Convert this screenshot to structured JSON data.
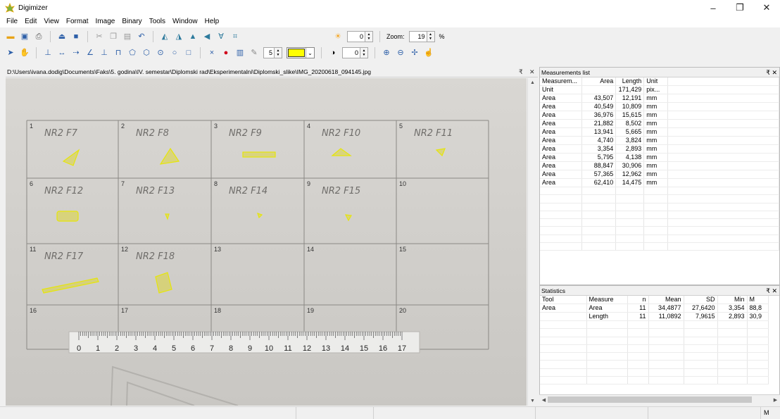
{
  "window": {
    "title": "Digimizer",
    "minimize": "–",
    "maximize": "❐",
    "close": "✕"
  },
  "menu": [
    "File",
    "Edit",
    "View",
    "Format",
    "Image",
    "Binary",
    "Tools",
    "Window",
    "Help"
  ],
  "toolbar": {
    "brightness_value": "0",
    "contrast_value": "0",
    "zoom_label": "Zoom:",
    "zoom_value": "19",
    "zoom_unit": "%",
    "line_width_value": "5",
    "fill_color": "#ffff00"
  },
  "image": {
    "path": "D:\\Users\\ivana.dodig\\Documents\\Faks\\5. godina\\IV. semestar\\Diplomski rad\\Eksperimentalni\\Diplomski_slike\\IMG_20200618_094145.jpg",
    "grid_numbers": [
      "1",
      "2",
      "3",
      "4",
      "5",
      "6",
      "7",
      "8",
      "9",
      "10",
      "11",
      "12",
      "13",
      "14",
      "15",
      "16",
      "17",
      "18",
      "19",
      "20"
    ],
    "labels": [
      "NR2 F7",
      "NR2 F8",
      "NR2 F9",
      "NR2 F10",
      "NR2 F11",
      "NR2 F12",
      "NR2 F13",
      "NR2 F14",
      "NR2 F15",
      "NR2 F17",
      "NR2 F18"
    ],
    "ruler_numbers": [
      "0",
      "1",
      "2",
      "3",
      "4",
      "5",
      "6",
      "7",
      "8",
      "9",
      "10",
      "11",
      "12",
      "13",
      "14",
      "15",
      "16",
      "17"
    ]
  },
  "measurements": {
    "title": "Measurements list",
    "headers": [
      "Measurem...",
      "Area",
      "Length",
      "Unit"
    ],
    "unit_row": [
      "Unit",
      "",
      "171,429",
      "pix..."
    ],
    "rows": [
      [
        "Area",
        "43,507",
        "12,191",
        "mm"
      ],
      [
        "Area",
        "40,549",
        "10,809",
        "mm"
      ],
      [
        "Area",
        "36,976",
        "15,615",
        "mm"
      ],
      [
        "Area",
        "21,882",
        "8,502",
        "mm"
      ],
      [
        "Area",
        "13,941",
        "5,665",
        "mm"
      ],
      [
        "Area",
        "4,740",
        "3,824",
        "mm"
      ],
      [
        "Area",
        "3,354",
        "2,893",
        "mm"
      ],
      [
        "Area",
        "5,795",
        "4,138",
        "mm"
      ],
      [
        "Area",
        "88,847",
        "30,906",
        "mm"
      ],
      [
        "Area",
        "57,365",
        "12,962",
        "mm"
      ],
      [
        "Area",
        "62,410",
        "14,475",
        "mm"
      ]
    ]
  },
  "statistics": {
    "title": "Statistics",
    "headers": [
      "Tool",
      "Measure",
      "n",
      "Mean",
      "SD",
      "Min",
      "M"
    ],
    "rows": [
      [
        "Area",
        "Area",
        "11",
        "34,4877",
        "27,6420",
        "3,354",
        "88,8"
      ],
      [
        "",
        "Length",
        "11",
        "11,0892",
        "7,9615",
        "2,893",
        "30,9"
      ]
    ]
  },
  "status": {
    "right": "M"
  },
  "panel_controls": {
    "pin": "₹",
    "close": "✕"
  }
}
